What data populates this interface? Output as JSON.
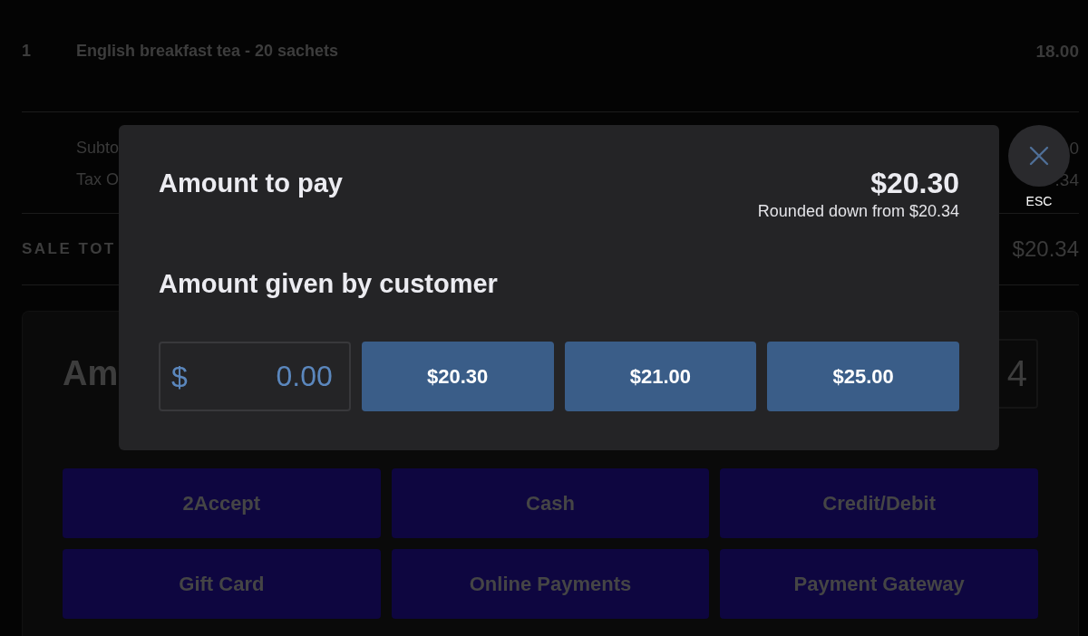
{
  "sale": {
    "line_items": [
      {
        "quantity": "1",
        "description": "English breakfast tea - 20 sachets",
        "amount": "18.00"
      }
    ],
    "summary_rows": [
      {
        "label": "Subto",
        "value": "0"
      },
      {
        "label": "Tax O",
        "value": ".34"
      }
    ],
    "total": {
      "label": "SALE TOT",
      "value": "$20.34"
    }
  },
  "payment_panel": {
    "heading": "Am",
    "amount_field": {
      "value": "4"
    },
    "methods": [
      "2Accept",
      "Cash",
      "Credit/Debit",
      "Gift Card",
      "Online Payments",
      "Payment Gateway"
    ]
  },
  "dialog": {
    "title": "Amount to pay",
    "amount": "$20.30",
    "rounding_note": "Rounded down from $20.34",
    "given_label": "Amount given by customer",
    "amount_field": {
      "currency_symbol": "$",
      "value": "0.00"
    },
    "quick_amounts": [
      "$20.30",
      "$21.00",
      "$25.00"
    ],
    "close": {
      "label": "ESC"
    }
  }
}
